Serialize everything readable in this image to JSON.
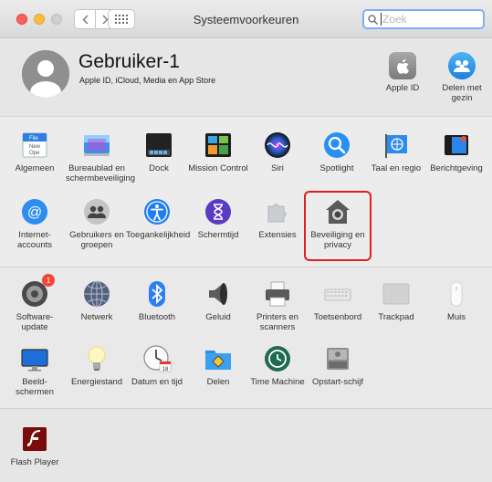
{
  "window": {
    "title": "Systeemvoorkeuren",
    "search_placeholder": "Zoek"
  },
  "account": {
    "name": "Gebruiker-1",
    "subtitle": "Apple ID, iCloud, Media en App Store",
    "items": [
      {
        "label": "Apple ID",
        "icon": "apple-id-icon"
      },
      {
        "label": "Delen met gezin",
        "icon": "family-sharing-icon"
      }
    ]
  },
  "row1": [
    {
      "label": "Algemeen",
      "icon": "general-icon"
    },
    {
      "label": "Bureaublad en schermbeveiliging",
      "icon": "desktop-screensaver-icon"
    },
    {
      "label": "Dock",
      "icon": "dock-icon"
    },
    {
      "label": "Mission Control",
      "icon": "mission-control-icon"
    },
    {
      "label": "Siri",
      "icon": "siri-icon"
    },
    {
      "label": "Spotlight",
      "icon": "spotlight-icon"
    },
    {
      "label": "Taal en regio",
      "icon": "language-region-icon"
    },
    {
      "label": "Berichtgeving",
      "icon": "notifications-icon"
    }
  ],
  "row2": [
    {
      "label": "Internet-accounts",
      "icon": "internet-accounts-icon"
    },
    {
      "label": "Gebruikers en groepen",
      "icon": "users-groups-icon"
    },
    {
      "label": "Toegankelijkheid",
      "icon": "accessibility-icon"
    },
    {
      "label": "Schermtijd",
      "icon": "screen-time-icon"
    },
    {
      "label": "Extensies",
      "icon": "extensions-icon"
    },
    {
      "label": "Beveiliging en privacy",
      "icon": "security-privacy-icon"
    }
  ],
  "row3": [
    {
      "label": "Software-update",
      "icon": "software-update-icon",
      "badge": "1"
    },
    {
      "label": "Netwerk",
      "icon": "network-icon"
    },
    {
      "label": "Bluetooth",
      "icon": "bluetooth-icon"
    },
    {
      "label": "Geluid",
      "icon": "sound-icon"
    },
    {
      "label": "Printers en scanners",
      "icon": "printers-scanners-icon"
    },
    {
      "label": "Toetsenbord",
      "icon": "keyboard-icon"
    },
    {
      "label": "Trackpad",
      "icon": "trackpad-icon"
    },
    {
      "label": "Muis",
      "icon": "mouse-icon"
    }
  ],
  "row4": [
    {
      "label": "Beeld-schermen",
      "icon": "displays-icon"
    },
    {
      "label": "Energiestand",
      "icon": "energy-saver-icon"
    },
    {
      "label": "Datum en tijd",
      "icon": "date-time-icon"
    },
    {
      "label": "Delen",
      "icon": "sharing-icon"
    },
    {
      "label": "Time Machine",
      "icon": "time-machine-icon"
    },
    {
      "label": "Opstart-schijf",
      "icon": "startup-disk-icon"
    }
  ],
  "row5": [
    {
      "label": "Flash Player",
      "icon": "flash-player-icon"
    }
  ]
}
